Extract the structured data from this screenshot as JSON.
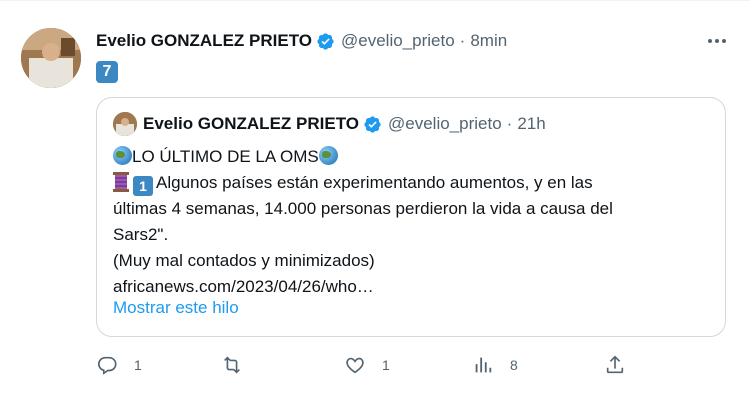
{
  "tweet": {
    "author_name": "Evelio GONZALEZ PRIETO",
    "handle": "@evelio_prieto",
    "separator": "·",
    "time": "8min",
    "text": "7"
  },
  "quoted": {
    "author_name": "Evelio GONZALEZ PRIETO",
    "handle": "@evelio_prieto",
    "separator": "·",
    "time": "21h",
    "line1": "LO ÚLTIMO DE LA OMS",
    "keycap_badge": "1",
    "line2": "Algunos países están experimentando aumentos, y en las",
    "line3": "últimas 4 semanas, 14.000 personas perdieron la vida a causa del",
    "line4": "Sars2\".",
    "line5": "(Muy mal contados y minimizados)",
    "link": "africanews.com/2023/04/26/who…",
    "show_thread": "Mostrar este hilo"
  },
  "actions": {
    "replies": "1",
    "retweets": "",
    "likes": "1",
    "views": "8"
  },
  "colors": {
    "verified": "#1d9bf0",
    "link_blue": "#1d9bf0",
    "muted": "#536471",
    "keycap": "#3b88c3"
  },
  "icons": [
    "verified-badge-icon",
    "more-icon",
    "reply-icon",
    "retweet-icon",
    "like-icon",
    "views-icon",
    "share-icon",
    "globe-icon",
    "spool-icon",
    "keycap-7-icon",
    "keycap-1-icon"
  ]
}
